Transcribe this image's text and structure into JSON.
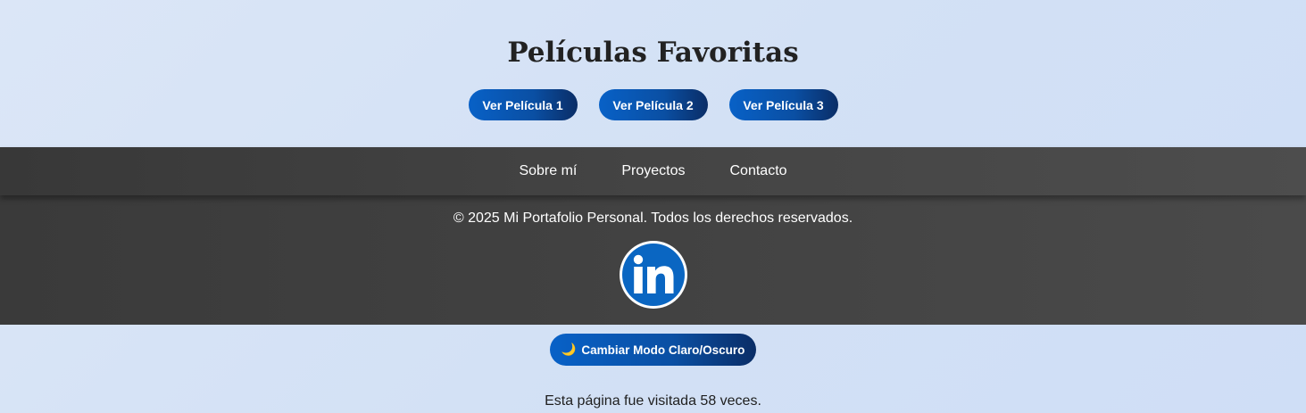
{
  "movies": {
    "title": "Películas Favoritas",
    "buttons": [
      "Ver Película 1",
      "Ver Película 2",
      "Ver Película 3"
    ]
  },
  "footer": {
    "nav": [
      "Sobre mí",
      "Proyectos",
      "Contacto"
    ],
    "copyright": "© 2025 Mi Portafolio Personal. Todos los derechos reservados.",
    "social_icon": "linkedin-icon"
  },
  "theme_toggle": {
    "icon": "🌙",
    "label": "Cambiar Modo Claro/Oscuro"
  },
  "visits": {
    "text": "Esta página fue visitada 58 veces."
  },
  "colors": {
    "button_start": "#0861c7",
    "button_end": "#0a2d66",
    "footer_bg": "#424242",
    "linkedin_blue": "#0a66c2"
  }
}
